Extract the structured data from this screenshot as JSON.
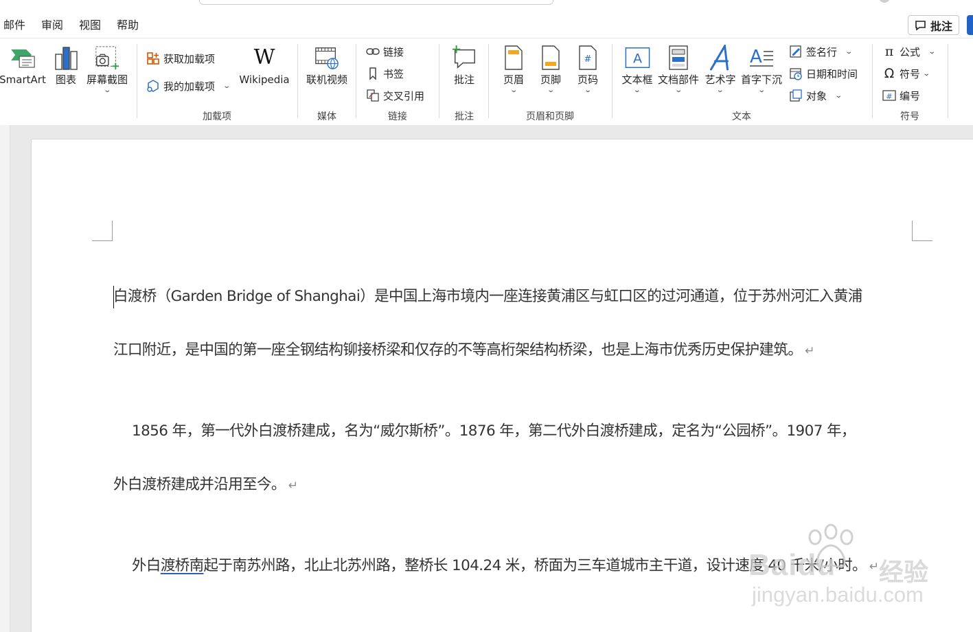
{
  "tabs": [
    "邮件",
    "审阅",
    "视图",
    "帮助"
  ],
  "comment_button": "批注",
  "ribbon": {
    "illustrations": {
      "smartart": "SmartArt",
      "chart": "图表",
      "screenshot": "屏幕截图"
    },
    "addins": {
      "get_addins": "获取加载项",
      "my_addins": "我的加载项",
      "wikipedia": "Wikipedia",
      "group": "加载项"
    },
    "media": {
      "online_video": "联机视频",
      "group": "媒体"
    },
    "links": {
      "link": "链接",
      "bookmark": "书签",
      "cross_ref": "交叉引用",
      "group": "链接"
    },
    "comments": {
      "comment": "批注",
      "group": "批注"
    },
    "header_footer": {
      "header": "页眉",
      "footer": "页脚",
      "page_number": "页码",
      "group": "页眉和页脚"
    },
    "text": {
      "textbox": "文本框",
      "quickparts": "文档部件",
      "wordart": "艺术字",
      "dropcap": "首字下沉",
      "signature": "签名行",
      "datetime": "日期和时间",
      "object": "对象",
      "group": "文本"
    },
    "symbols": {
      "equation": "公式",
      "symbol": "符号",
      "numbering": "编号",
      "group": "符号"
    }
  },
  "document": {
    "p1_line1": "白渡桥（Garden Bridge of Shanghai）是中国上海市境内一座连接黄浦区与虹口区的过河通道，位于苏州河汇入黄浦",
    "p1_line2": "江口附近，是中国的第一座全钢结构铆接桥梁和仅存的不等高桁架结构桥梁，也是上海市优秀历史保护建筑。",
    "p2_line1": "1856 年，第一代外白渡桥建成，名为“威尔斯桥”。1876 年，第二代外白渡桥建成，定名为“公园桥”。1907 年，",
    "p2_line2": "外白渡桥建成并沿用至今。",
    "p3_pre": "外白",
    "p3_underlined": "渡桥南",
    "p3_post": "起于南苏州路，北止北苏州路，整桥长 104.24 米，桥面为三车道城市主干道，设计速度 40 千米/小时。",
    "para_mark": "↵"
  },
  "watermark": {
    "brand": "Baidu",
    "suffix": "经验",
    "url": "jingyan.baidu.com"
  }
}
